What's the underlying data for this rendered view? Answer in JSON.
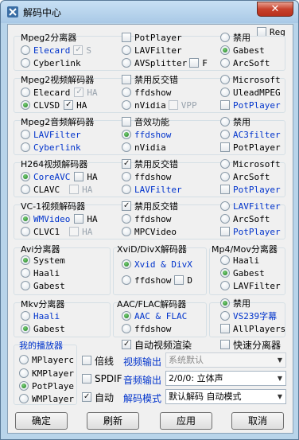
{
  "window": {
    "title": "解码中心",
    "close_glyph": "✕",
    "icon": "tools-icon"
  },
  "reg": "Reg",
  "mpeg2_splitter": {
    "title": "Mpeg2分离器",
    "col1": [
      "Elecard",
      "Cyberlink"
    ],
    "s_label": "S",
    "col2": [
      "PotPlayer",
      "LAVFilter",
      "AVSplitter"
    ],
    "f_label": "F",
    "col3": [
      "禁用",
      "Gabest",
      "ArcSoft"
    ]
  },
  "mpeg2_video": {
    "title": "Mpeg2视频解码器",
    "col1": [
      "Elecard",
      "CLVSD"
    ],
    "ha1": "HA",
    "ha2": "HA",
    "col2": [
      "禁用反交错",
      "ffdshow",
      "nVidia"
    ],
    "vpp": "VPP",
    "col3": [
      "Microsoft",
      "UleadMPEG",
      "PotPlayer"
    ]
  },
  "mpeg2_audio": {
    "title": "Mpeg2音频解码器",
    "col1": [
      "LAVFilter",
      "Cyberlink"
    ],
    "col2": [
      "音效功能",
      "ffdshow",
      "nVidia"
    ],
    "col3": [
      "禁用",
      "AC3filter",
      "PotPlayer"
    ]
  },
  "h264": {
    "title": "H264视频解码器",
    "col1": [
      "CoreAVC",
      "CLAVC"
    ],
    "ha1": "HA",
    "ha2": "HA",
    "col2": [
      "禁用反交错",
      "ffdshow",
      "LAVFilter"
    ],
    "col3": [
      "Microsoft",
      "ArcSoft",
      "PotPlayer"
    ]
  },
  "vc1": {
    "title": "VC-1视频解码器",
    "col1": [
      "WMVideo",
      "CLVC1"
    ],
    "ha1": "HA",
    "ha2": "HA",
    "col2": [
      "禁用反交错",
      "ffdshow",
      "MPCVideo"
    ],
    "col3": [
      "LAVFilter",
      "ArcSoft",
      "PotPlayer"
    ]
  },
  "avi": {
    "title": "Avi分离器",
    "items": [
      "System",
      "Haali",
      "Gabest"
    ]
  },
  "xvid": {
    "title": "XviD/DivX解码器",
    "items": [
      "Xvid & DivX",
      "ffdshow"
    ],
    "d_label": "D"
  },
  "mp4": {
    "title": "Mp4/Mov分离器",
    "items": [
      "Haali",
      "Gabest",
      "LAVFilter"
    ]
  },
  "mkv": {
    "title": "Mkv分离器",
    "items": [
      "Haali",
      "Gabest"
    ]
  },
  "aac": {
    "title": "AAC/FLAC解码器",
    "items": [
      "AAC & FLAC",
      "ffdshow"
    ]
  },
  "misc": {
    "items": [
      "禁用",
      "VS239字幕",
      "AllPlayers"
    ]
  },
  "player": {
    "title": "我的播放器",
    "items": [
      "MPlayerc",
      "KMPlayer",
      "PotPlaye",
      "WMPlayer"
    ]
  },
  "auto_render": "自动视频渲染",
  "fast_splitter": "快速分离器",
  "double": "倍线",
  "video_out_label": "视频输出",
  "video_out_value": "系统默认",
  "spdif": "SPDIF",
  "audio_out_label": "音频输出",
  "audio_out_value": "2/0/0: 立体声",
  "auto": "自动",
  "decode_mode_label": "解码模式",
  "decode_mode_value": "默认解码 自动模式",
  "buttons": {
    "ok": "确定",
    "refresh": "刷新",
    "apply": "应用",
    "cancel": "取消"
  },
  "colors": {
    "link_blue": "#0033cc",
    "title_bar": "#b8d4ea",
    "close_red": "#c7412c"
  }
}
